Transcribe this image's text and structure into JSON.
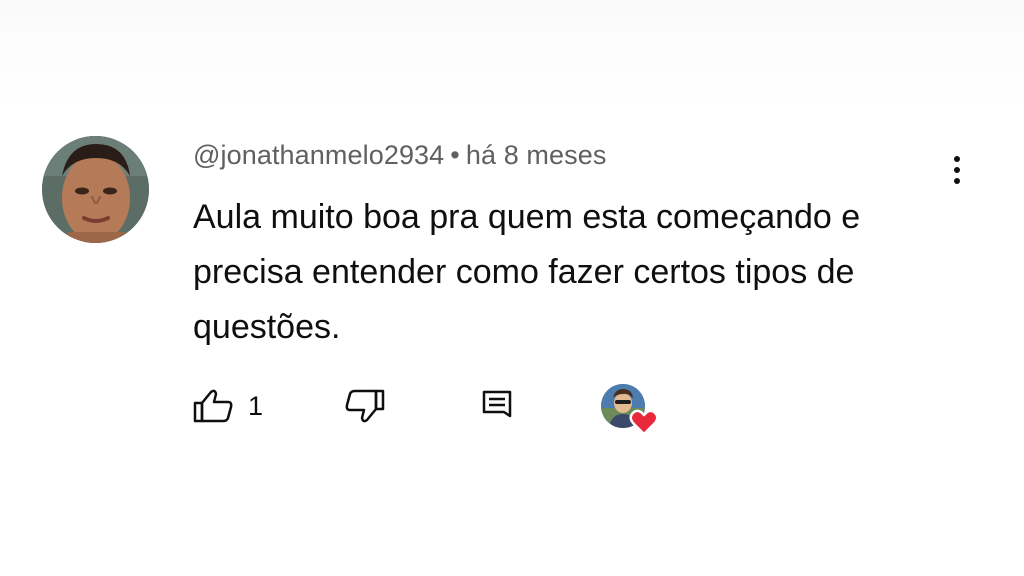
{
  "comment": {
    "author": "@jonathanmelo2934",
    "separator": "•",
    "timestamp": "há 8 meses",
    "text": "Aula muito boa pra quem esta começando e precisa entender como fazer certos tipos de questões.",
    "like_count": "1"
  },
  "icons": {
    "more": "more-vert-icon",
    "like": "thumb-up-icon",
    "dislike": "thumb-down-icon",
    "reply": "reply-comment-icon",
    "heart": "heart-icon"
  },
  "colors": {
    "text_primary": "#0f0f0f",
    "text_secondary": "#606060",
    "heart": "#e8293b",
    "background": "#ffffff"
  }
}
